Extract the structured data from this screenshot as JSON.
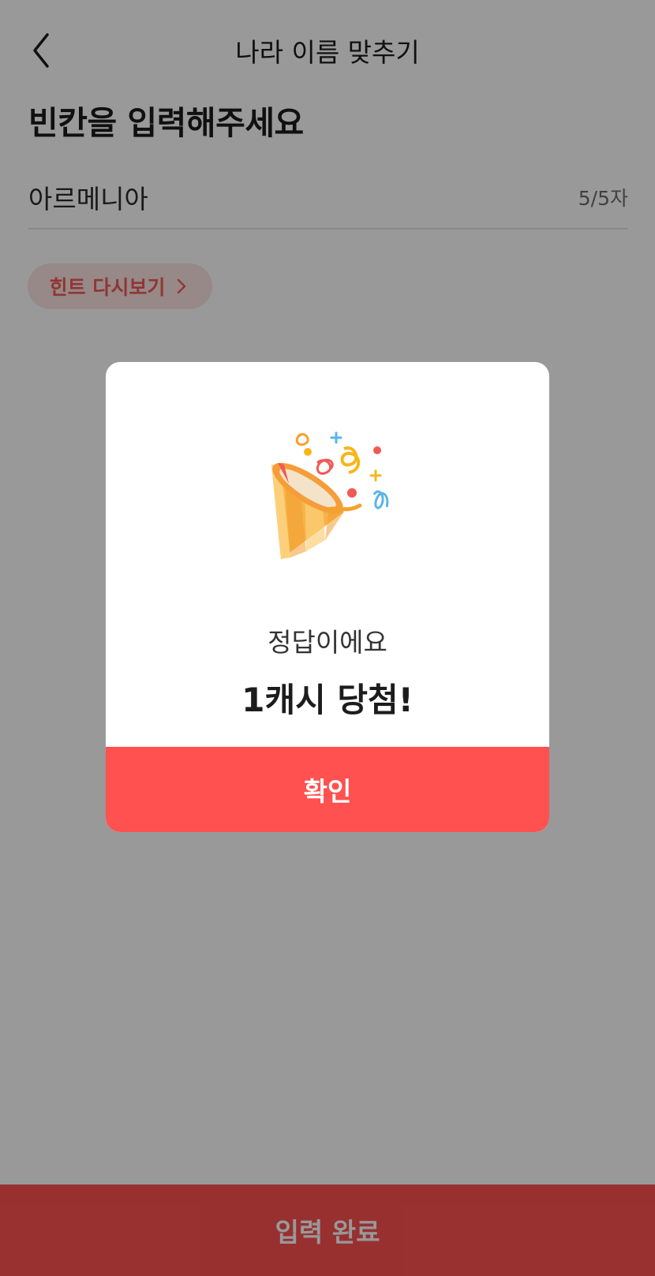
{
  "header": {
    "title": "나라 이름 맞추기",
    "back_icon": "chevron-left-icon"
  },
  "quiz": {
    "heading": "빈칸을 입력해주세요",
    "answer": "아르메니아",
    "char_count": "5/5자",
    "hint_label": "힌트 다시보기"
  },
  "bottom": {
    "submit_label": "입력 완료"
  },
  "modal": {
    "icon": "party-popper-icon",
    "subtitle": "정답이에요",
    "title": "1캐시 당첨!",
    "confirm_label": "확인"
  },
  "colors": {
    "accent": "#fe5150",
    "hint_bg": "#fbe4e3",
    "hint_text": "#f15b57",
    "overlay": "rgba(0,0,0,0.40)"
  }
}
